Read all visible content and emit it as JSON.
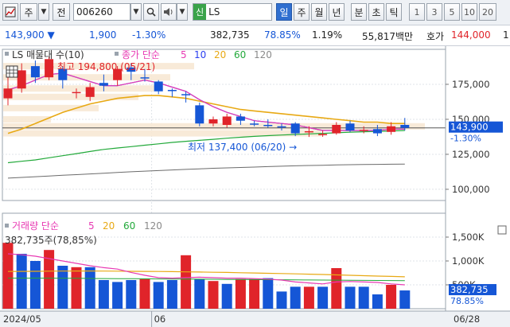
{
  "toolbar": {
    "market": "주",
    "mode": "전",
    "code": "006260",
    "name_tag": "신",
    "name": "LS",
    "periods": [
      "일",
      "주",
      "월",
      "년",
      "분",
      "초",
      "틱"
    ],
    "active_period": "일",
    "intervals": [
      "1",
      "3",
      "5",
      "10",
      "20"
    ]
  },
  "quote": {
    "price": "143,900",
    "change": "1,900",
    "change_pct": "-1.30%",
    "volume": "382,735",
    "vol_ratio": "78.85%",
    "turnover": "1.19%",
    "amount": "55,817백만",
    "ask_label": "호가",
    "ask_price": "144,000",
    "ask_tail": "1"
  },
  "colors": {
    "up": "#e0242a",
    "down": "#1556d6",
    "ma5": "#e83ab3",
    "ma10": "#2a3ef0",
    "ma20": "#e8a914",
    "ma60": "#22a93a",
    "ma120": "#8a8a8a"
  },
  "chart_data": {
    "type": "candlestick",
    "legend": {
      "title": "LS 매물대 수(10)",
      "ma_label": "종가 단순",
      "ma_periods": [
        "5",
        "10",
        "20",
        "60",
        "120"
      ]
    },
    "high_note": "최고 194,800 (05/21)",
    "low_note": "최저 137,400 (06/20)",
    "y_ticks": [
      {
        "value": 175000,
        "label": "175,000"
      },
      {
        "value": 150000,
        "label": "150,000"
      },
      {
        "value": 125000,
        "label": "125,000"
      },
      {
        "value": 100000,
        "label": "100,000"
      }
    ],
    "ylim": [
      92000,
      200000
    ],
    "last_price_label": "143,900",
    "last_change_label": "-1.30%",
    "candles": [
      {
        "o": 165000,
        "c": 172000,
        "h": 180000,
        "l": 160000
      },
      {
        "o": 172000,
        "c": 185000,
        "h": 190000,
        "l": 169000
      },
      {
        "o": 188000,
        "c": 180000,
        "h": 192000,
        "l": 176000
      },
      {
        "o": 180000,
        "c": 193000,
        "h": 194800,
        "l": 178000
      },
      {
        "o": 186000,
        "c": 178000,
        "h": 188000,
        "l": 172000
      },
      {
        "o": 169000,
        "c": 169500,
        "h": 172000,
        "l": 165000
      },
      {
        "o": 166000,
        "c": 173000,
        "h": 176000,
        "l": 163000
      },
      {
        "o": 176000,
        "c": 174000,
        "h": 182000,
        "l": 170000
      },
      {
        "o": 178000,
        "c": 186000,
        "h": 188000,
        "l": 174000
      },
      {
        "o": 187000,
        "c": 184000,
        "h": 190000,
        "l": 178000
      },
      {
        "o": 180000,
        "c": 179500,
        "h": 186000,
        "l": 177000
      },
      {
        "o": 177000,
        "c": 170000,
        "h": 178000,
        "l": 168000
      },
      {
        "o": 171000,
        "c": 170500,
        "h": 172000,
        "l": 166000
      },
      {
        "o": 168000,
        "c": 167500,
        "h": 170000,
        "l": 162000
      },
      {
        "o": 160000,
        "c": 147000,
        "h": 162000,
        "l": 145000
      },
      {
        "o": 147000,
        "c": 150000,
        "h": 152000,
        "l": 145000
      },
      {
        "o": 146000,
        "c": 152000,
        "h": 154000,
        "l": 144000
      },
      {
        "o": 152000,
        "c": 149000,
        "h": 154000,
        "l": 146000
      },
      {
        "o": 147000,
        "c": 146500,
        "h": 149000,
        "l": 145000
      },
      {
        "o": 146000,
        "c": 145500,
        "h": 150000,
        "l": 144000
      },
      {
        "o": 145000,
        "c": 144500,
        "h": 147000,
        "l": 142000
      },
      {
        "o": 147000,
        "c": 140000,
        "h": 148000,
        "l": 138000
      },
      {
        "o": 141000,
        "c": 141500,
        "h": 145000,
        "l": 137400
      },
      {
        "o": 139000,
        "c": 139500,
        "h": 142000,
        "l": 137500
      },
      {
        "o": 140000,
        "c": 146000,
        "h": 148000,
        "l": 139000
      },
      {
        "o": 147000,
        "c": 142000,
        "h": 149000,
        "l": 141000
      },
      {
        "o": 142000,
        "c": 142500,
        "h": 145000,
        "l": 140000
      },
      {
        "o": 143000,
        "c": 140000,
        "h": 146000,
        "l": 138000
      },
      {
        "o": 141000,
        "c": 145000,
        "h": 148000,
        "l": 139000
      },
      {
        "o": 146000,
        "c": 143900,
        "h": 151000,
        "l": 142000
      }
    ],
    "ma5": [
      171000,
      174000,
      178000,
      182000,
      183000,
      180000,
      177000,
      174000,
      174000,
      176000,
      178000,
      176000,
      173000,
      170000,
      164000,
      159000,
      155000,
      152000,
      149000,
      148000,
      147000,
      146000,
      144000,
      142000,
      142000,
      142000,
      142000,
      142000,
      143000,
      143000
    ],
    "ma20": [
      140000,
      143000,
      147000,
      151000,
      155000,
      158000,
      161000,
      163000,
      165000,
      166000,
      167000,
      167000,
      166000,
      165000,
      163000,
      161000,
      159000,
      157000,
      156000,
      155000,
      154000,
      153000,
      152000,
      151000,
      150000,
      149000,
      148000,
      148000,
      147000,
      147000
    ],
    "ma60": [
      119000,
      120000,
      121000,
      122500,
      124000,
      125500,
      127000,
      128500,
      129500,
      130500,
      131500,
      132500,
      133500,
      134300,
      135000,
      135700,
      136500,
      137200,
      137800,
      138300,
      138800,
      139200,
      139600,
      140000,
      140400,
      140800,
      141100,
      141400,
      141700,
      142000
    ],
    "ma120": [
      108000,
      108500,
      109000,
      109500,
      110000,
      110500,
      111000,
      111500,
      112000,
      112500,
      113000,
      113400,
      113800,
      114200,
      114600,
      115000,
      115300,
      115600,
      115900,
      116200,
      116500,
      116800,
      117000,
      117200,
      117400,
      117600,
      117700,
      117800,
      117900,
      118000
    ],
    "volume": {
      "legend_title": "거래량",
      "ma_label": "단순",
      "ma_periods": [
        "5",
        "20",
        "60",
        "120"
      ],
      "value_label": "382,735주(78,85%)",
      "y_ticks": [
        {
          "value": 1500000,
          "label": "1,500K"
        },
        {
          "value": 1000000,
          "label": "1,000K"
        },
        {
          "value": 500000,
          "label": "500K"
        }
      ],
      "ylim": [
        0,
        1800000
      ],
      "last_label": "382,735",
      "last_pct": "78.85%",
      "bars": [
        {
          "v": 1380000,
          "up": true
        },
        {
          "v": 1150000,
          "up": false
        },
        {
          "v": 1000000,
          "up": false
        },
        {
          "v": 1230000,
          "up": true
        },
        {
          "v": 900000,
          "up": false
        },
        {
          "v": 870000,
          "up": true
        },
        {
          "v": 870000,
          "up": false
        },
        {
          "v": 600000,
          "up": false
        },
        {
          "v": 560000,
          "up": false
        },
        {
          "v": 600000,
          "up": false
        },
        {
          "v": 620000,
          "up": true
        },
        {
          "v": 560000,
          "up": false
        },
        {
          "v": 600000,
          "up": false
        },
        {
          "v": 1120000,
          "up": true
        },
        {
          "v": 620000,
          "up": false
        },
        {
          "v": 580000,
          "up": true
        },
        {
          "v": 520000,
          "up": false
        },
        {
          "v": 620000,
          "up": true
        },
        {
          "v": 620000,
          "up": true
        },
        {
          "v": 640000,
          "up": false
        },
        {
          "v": 360000,
          "up": false
        },
        {
          "v": 460000,
          "up": false
        },
        {
          "v": 460000,
          "up": true
        },
        {
          "v": 460000,
          "up": false
        },
        {
          "v": 850000,
          "up": true
        },
        {
          "v": 460000,
          "up": false
        },
        {
          "v": 460000,
          "up": false
        },
        {
          "v": 300000,
          "up": false
        },
        {
          "v": 500000,
          "up": true
        },
        {
          "v": 382735,
          "up": false
        }
      ],
      "ma5": [
        1150000,
        1130000,
        1100000,
        1050000,
        1000000,
        950000,
        900000,
        860000,
        830000,
        760000,
        700000,
        650000,
        640000,
        650000,
        660000,
        650000,
        640000,
        640000,
        630000,
        620000,
        600000,
        560000,
        540000,
        520000,
        560000,
        570000,
        560000,
        550000,
        520000,
        500000
      ],
      "ma20": [
        780000,
        782000,
        784000,
        786000,
        788000,
        790000,
        790000,
        788000,
        786000,
        784000,
        782000,
        780000,
        776000,
        772000,
        768000,
        764000,
        760000,
        754000,
        748000,
        742000,
        736000,
        730000,
        724000,
        716000,
        708000,
        700000,
        692000,
        684000,
        676000,
        668000
      ],
      "ma60": [
        640000,
        640000,
        640000,
        640000,
        638000,
        636000,
        634000,
        632000,
        630000,
        628000,
        626000,
        624000,
        622000,
        620000,
        618000,
        616000,
        614000,
        612000,
        610000,
        608000,
        606000,
        604000,
        602000,
        600000,
        598000,
        596000,
        594000,
        592000,
        590000,
        588000
      ]
    },
    "x_labels": {
      "start": "2024/05",
      "month": "06",
      "end": "06/28"
    }
  }
}
